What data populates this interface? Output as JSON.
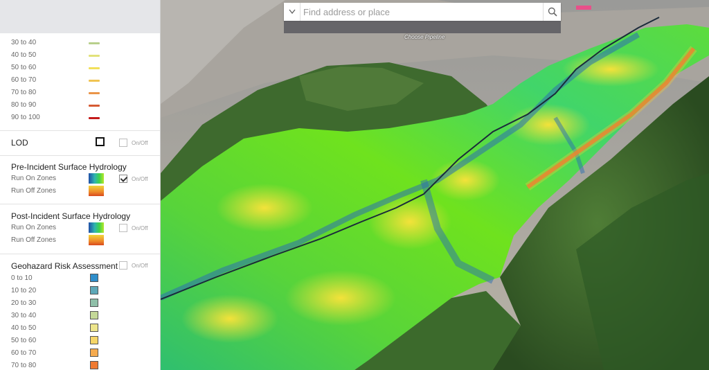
{
  "search": {
    "placeholder": "Find address or place",
    "pipeline_label": "Choose Pipeline"
  },
  "legend_top": {
    "items": [
      {
        "label": "30 to 40",
        "color": "#b8d08c"
      },
      {
        "label": "40 to 50",
        "color": "#e2e27a"
      },
      {
        "label": "50 to 60",
        "color": "#f2e05a"
      },
      {
        "label": "60 to 70",
        "color": "#f0c452"
      },
      {
        "label": "70 to 80",
        "color": "#ea9448"
      },
      {
        "label": "80 to 90",
        "color": "#d65a33"
      },
      {
        "label": "90 to 100",
        "color": "#c41a1a"
      }
    ]
  },
  "lod": {
    "title": "LOD",
    "toggle": "On/Off",
    "checked": false
  },
  "pre_incident": {
    "title": "Pre-Incident Surface Hydrology",
    "run_on": "Run On Zones",
    "run_off": "Run Off Zones",
    "toggle": "On/Off",
    "checked": true
  },
  "post_incident": {
    "title": "Post-Incident Surface Hydrology",
    "run_on": "Run On Zones",
    "run_off": "Run Off Zones",
    "toggle": "On/Off",
    "checked": false
  },
  "geohazard": {
    "title": "Geohazard Risk Assessment",
    "toggle": "On/Off",
    "checked": false,
    "items": [
      {
        "label": "0 to 10",
        "color": "#2f8ecb"
      },
      {
        "label": "10 to 20",
        "color": "#5fa8b8"
      },
      {
        "label": "20 to 30",
        "color": "#8fbfa8"
      },
      {
        "label": "30 to 40",
        "color": "#c4d898"
      },
      {
        "label": "40 to 50",
        "color": "#ede58c"
      },
      {
        "label": "50 to 60",
        "color": "#f5d668"
      },
      {
        "label": "60 to 70",
        "color": "#f5aa4e"
      },
      {
        "label": "70 to 80",
        "color": "#ef7a32"
      }
    ]
  }
}
